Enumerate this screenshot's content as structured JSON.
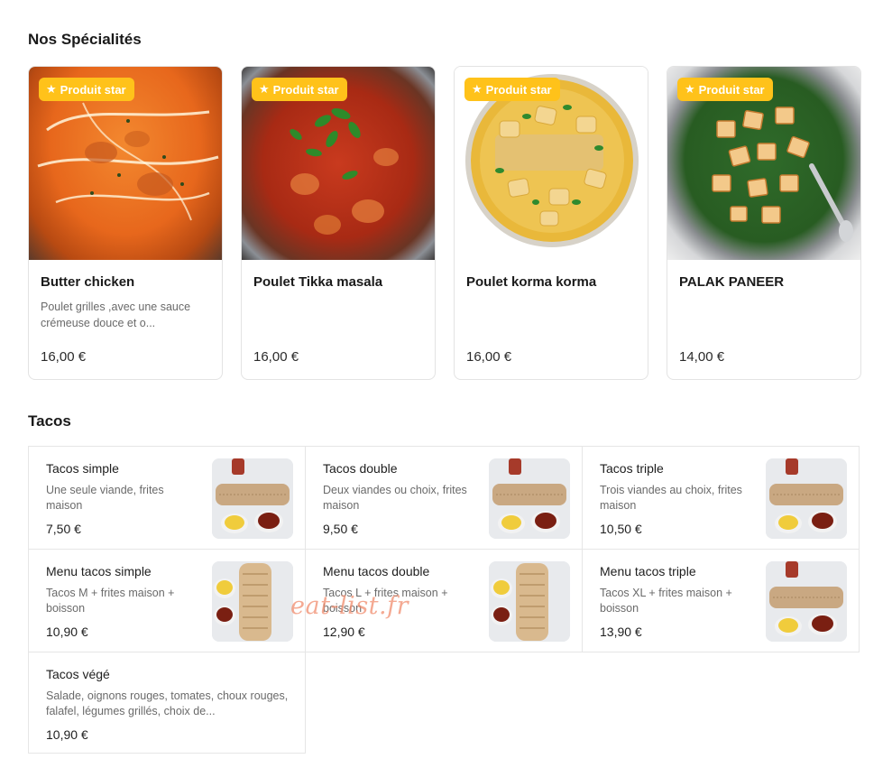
{
  "sections": {
    "specialites_title": "Nos Spécialités",
    "tacos_title": "Tacos"
  },
  "badge_label": "Produit star",
  "featured": [
    {
      "name": "Butter chicken",
      "description": "Poulet grilles ,avec une sauce crémeuse douce et o...",
      "price": "16,00 €"
    },
    {
      "name": "Poulet Tikka masala",
      "description": "",
      "price": "16,00 €"
    },
    {
      "name": "Poulet korma korma",
      "description": "",
      "price": "16,00 €"
    },
    {
      "name": "PALAK PANEER",
      "description": "",
      "price": "14,00 €"
    }
  ],
  "tacos": [
    {
      "name": "Tacos simple",
      "description": "Une seule viande, frites maison",
      "price": "7,50 €"
    },
    {
      "name": "Tacos double",
      "description": "Deux viandes ou choix, frites maison",
      "price": "9,50 €"
    },
    {
      "name": "Tacos triple",
      "description": "Trois viandes au choix, frites maison",
      "price": "10,50 €"
    },
    {
      "name": "Menu tacos simple",
      "description": "Tacos M + frites maison + boisson",
      "price": "10,90 €"
    },
    {
      "name": "Menu tacos double",
      "description": "Tacos L + frites maison + boisson",
      "price": "12,90 €"
    },
    {
      "name": "Menu tacos triple",
      "description": "Tacos XL + frites maison + boisson",
      "price": "13,90 €"
    },
    {
      "name": "Tacos végé",
      "description": "Salade, oignons rouges, tomates, choux rouges, falafel, légumes grillés, choix de...",
      "price": "10,90 €"
    }
  ],
  "watermark": "eat-list.fr",
  "colors": {
    "badge": "#ffc21a",
    "border": "#e3e3e3",
    "muted_text": "#6a6a6a"
  },
  "icons": {
    "badge_icon": "star-icon"
  }
}
